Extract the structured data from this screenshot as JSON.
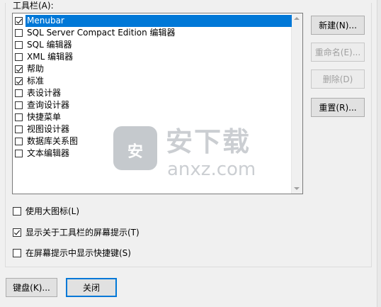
{
  "toolbars_label": "工具栏(A):",
  "toolbar_items": [
    {
      "label": "Menubar",
      "checked": true,
      "selected": true
    },
    {
      "label": "SQL Server Compact Edition 编辑器",
      "checked": false
    },
    {
      "label": "SQL 编辑器",
      "checked": false
    },
    {
      "label": "XML 编辑器",
      "checked": false
    },
    {
      "label": "帮助",
      "checked": true
    },
    {
      "label": "标准",
      "checked": true
    },
    {
      "label": "表设计器",
      "checked": false
    },
    {
      "label": "查询设计器",
      "checked": false
    },
    {
      "label": "快捷菜单",
      "checked": false
    },
    {
      "label": "视图设计器",
      "checked": false
    },
    {
      "label": "数据库关系图",
      "checked": false
    },
    {
      "label": "文本编辑器",
      "checked": false
    }
  ],
  "buttons": {
    "new": "新建(N)...",
    "rename": "重命名(E)...",
    "delete": "删除(D)",
    "reset": "重置(R)..."
  },
  "options": {
    "large_icons": {
      "label": "使用大图标(L)",
      "checked": false
    },
    "show_tips": {
      "label": "显示关于工具栏的屏幕提示(T)",
      "checked": true
    },
    "show_shortcuts": {
      "label": "在屏幕提示中显示快捷键(S)",
      "checked": false
    }
  },
  "footer": {
    "keyboard": "键盘(K)...",
    "close": "关闭"
  },
  "watermark": {
    "logo_text": "安",
    "title": "安下载",
    "site": "anxz.com"
  }
}
